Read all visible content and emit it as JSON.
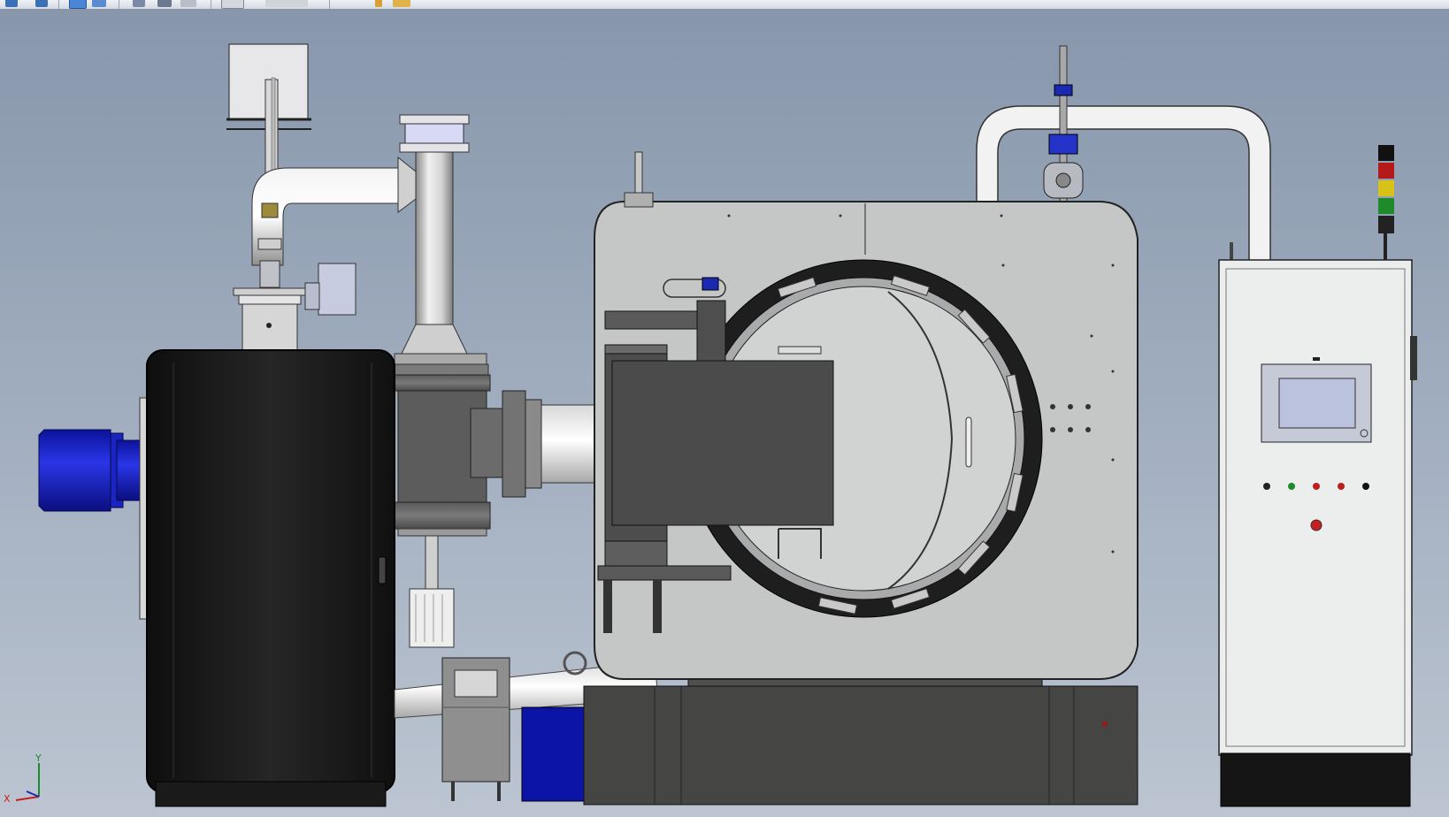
{
  "app": {
    "toolbar_icons": [
      "undo-icon",
      "redo-icon",
      "view-icon",
      "display-icon",
      "rotate-icon",
      "pan-icon",
      "section-icon",
      "appearance-icon",
      "scene-icon"
    ]
  },
  "colors": {
    "background_top": "#8796ab",
    "background_bottom": "#bcc5d1",
    "motor_blue": "#1f26c8",
    "black_housing": "#1d1d1d",
    "chamber_grey": "#c8c9c9",
    "cabinet_white": "#eceeee",
    "base_dark": "#454544"
  },
  "triad": {
    "x_label": "X",
    "y_label": "Y"
  }
}
